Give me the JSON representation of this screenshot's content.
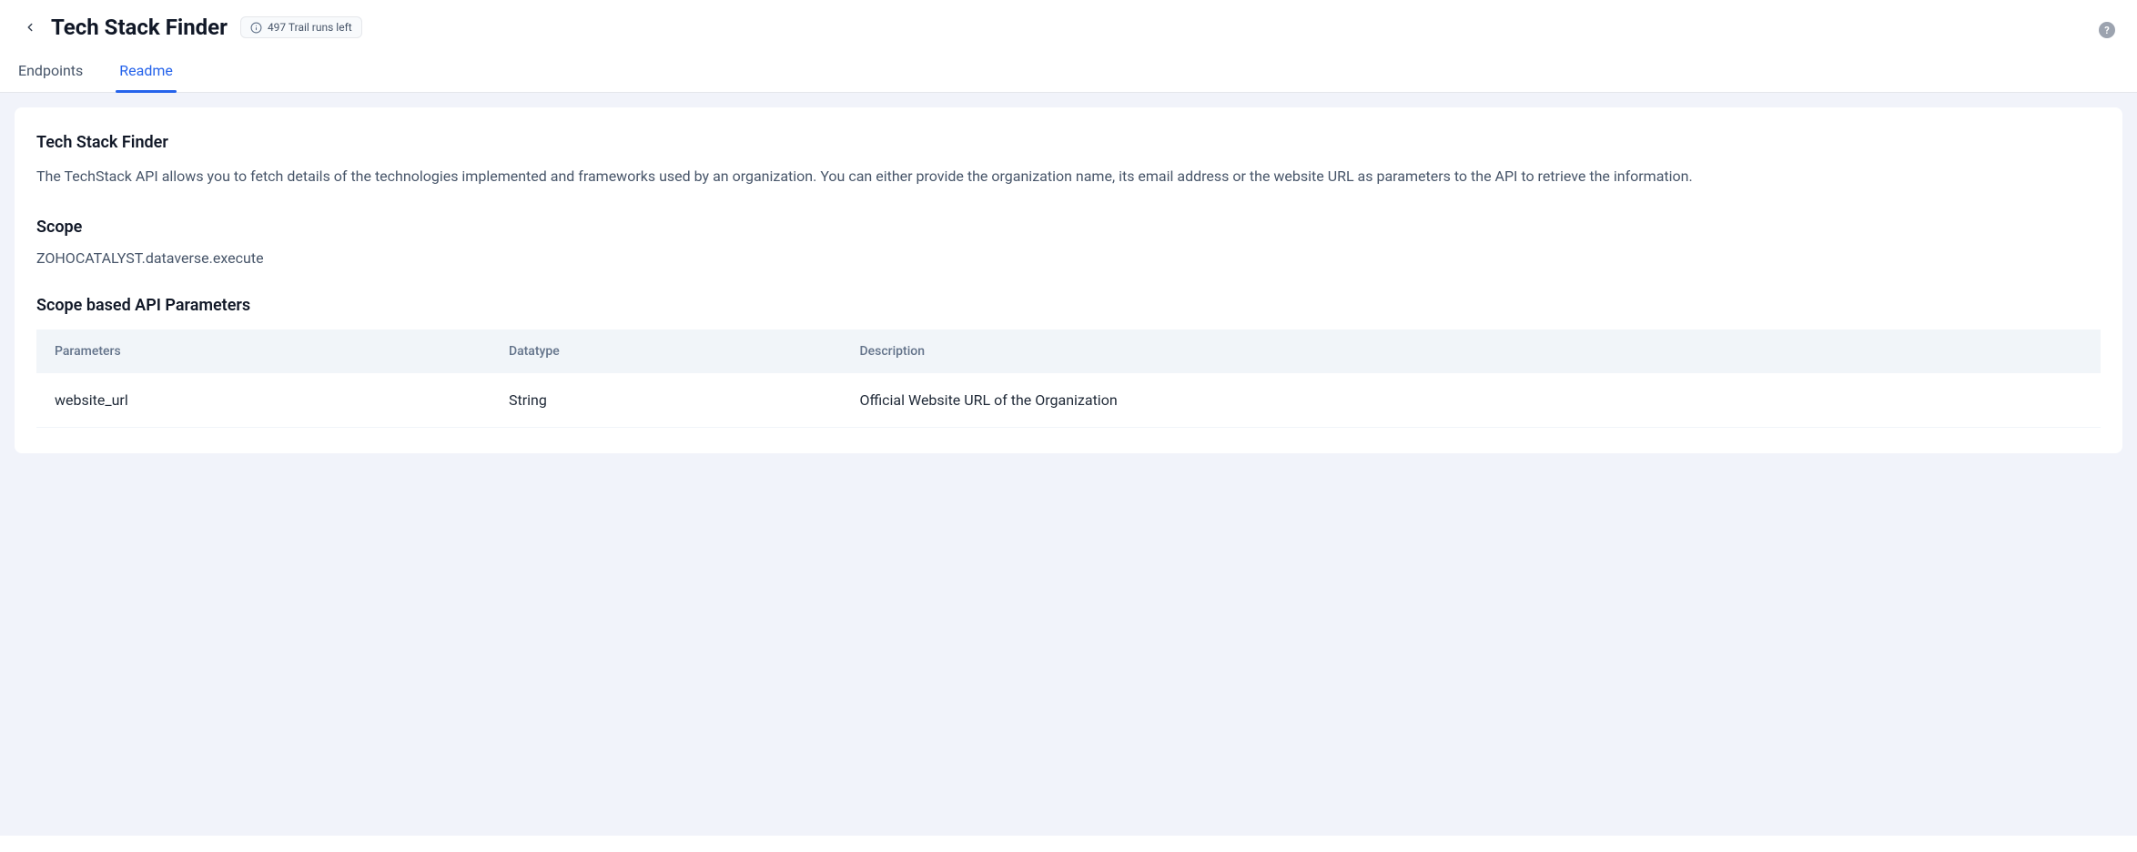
{
  "header": {
    "title": "Tech Stack Finder",
    "badge_text": "497 Trail runs left"
  },
  "tabs": [
    {
      "label": "Endpoints",
      "active": false
    },
    {
      "label": "Readme",
      "active": true
    }
  ],
  "readme": {
    "heading1": "Tech Stack Finder",
    "description": "The TechStack API allows you to fetch details of the technologies implemented and frameworks used by an organization. You can either provide the organization name, its email address or the website URL as parameters to the API to retrieve the information.",
    "scope_heading": "Scope",
    "scope_value": "ZOHOCATALYST.dataverse.execute",
    "params_heading": "Scope based API Parameters",
    "table": {
      "columns": [
        "Parameters",
        "Datatype",
        "Description"
      ],
      "rows": [
        {
          "param": "website_url",
          "datatype": "String",
          "description": "Official Website URL of the Organization"
        }
      ]
    }
  }
}
